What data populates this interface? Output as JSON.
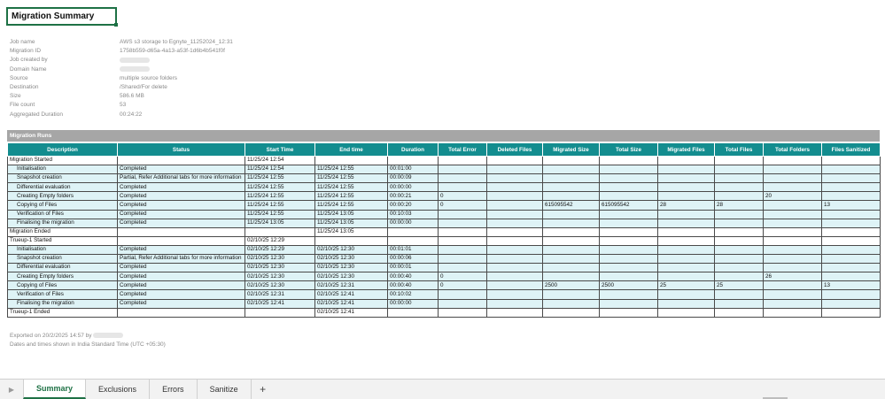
{
  "sheet": {
    "title": "Migration Summary"
  },
  "info": [
    {
      "label": "Job name",
      "value": "AWS s3 storage to Egnyte_11252024_12:31"
    },
    {
      "label": "Migration ID",
      "value": "1758b559-d65a-4a13-a53f-1d6b4b541f0f"
    },
    {
      "label": "Job created by",
      "value": ""
    },
    {
      "label": "Domain Name",
      "value": ""
    },
    {
      "label": "Source",
      "value": "multiple source folders"
    },
    {
      "label": "Destination",
      "value": "/Shared/For delete"
    },
    {
      "label": "Size",
      "value": "586.6 MB"
    },
    {
      "label": "File count",
      "value": "53"
    },
    {
      "label": "Aggregated Duration",
      "value": "00:24:22"
    }
  ],
  "runs": {
    "heading": "Migration Runs",
    "columns": [
      "Description",
      "Status",
      "Start Time",
      "End time",
      "Duration",
      "Total Error",
      "Deleted Files",
      "Migrated Size",
      "Total Size",
      "Migrated Files",
      "Total Files",
      "Total Folders",
      "Files Sanitized"
    ],
    "rows": [
      {
        "kind": "top",
        "cells": [
          "Migration Started",
          "",
          "11/25/24 12:54",
          "",
          "",
          "",
          "",
          "",
          "",
          "",
          "",
          "",
          ""
        ]
      },
      {
        "kind": "sub",
        "cells": [
          "Initialisation",
          "Completed",
          "11/25/24 12:54",
          "11/25/24 12:55",
          "00:01:00",
          "",
          "",
          "",
          "",
          "",
          "",
          "",
          ""
        ]
      },
      {
        "kind": "sub",
        "cells": [
          "Snapshot creation",
          "Partial, Refer Additional tabs for more information",
          "11/25/24 12:55",
          "11/25/24 12:55",
          "00:00:09",
          "",
          "",
          "",
          "",
          "",
          "",
          "",
          ""
        ]
      },
      {
        "kind": "sub",
        "cells": [
          "Differential evaluation",
          "Completed",
          "11/25/24 12:55",
          "11/25/24 12:55",
          "00:00:00",
          "",
          "",
          "",
          "",
          "",
          "",
          "",
          ""
        ]
      },
      {
        "kind": "sub",
        "cells": [
          "Creating Empty folders",
          "Completed",
          "11/25/24 12:55",
          "11/25/24 12:55",
          "00:00:21",
          "0",
          "",
          "",
          "",
          "",
          "",
          "20",
          ""
        ]
      },
      {
        "kind": "sub",
        "cells": [
          "Copying of Files",
          "Completed",
          "11/25/24 12:55",
          "11/25/24 12:55",
          "00:00:20",
          "0",
          "",
          "615095542",
          "615095542",
          "28",
          "28",
          "",
          "13"
        ]
      },
      {
        "kind": "sub",
        "cells": [
          "Verification of Files",
          "Completed",
          "11/25/24 12:55",
          "11/25/24 13:05",
          "00:10:03",
          "",
          "",
          "",
          "",
          "",
          "",
          "",
          ""
        ]
      },
      {
        "kind": "sub",
        "cells": [
          "Finalising the migration",
          "Completed",
          "11/25/24 13:05",
          "11/25/24 13:05",
          "00:00:00",
          "",
          "",
          "",
          "",
          "",
          "",
          "",
          ""
        ]
      },
      {
        "kind": "top",
        "cells": [
          "Migration Ended",
          "",
          "",
          "11/25/24 13:05",
          "",
          "",
          "",
          "",
          "",
          "",
          "",
          "",
          ""
        ]
      },
      {
        "kind": "top",
        "cells": [
          "Trueup-1 Started",
          "",
          "02/10/25 12:29",
          "",
          "",
          "",
          "",
          "",
          "",
          "",
          "",
          "",
          ""
        ]
      },
      {
        "kind": "sub",
        "cells": [
          "Initialisation",
          "Completed",
          "02/10/25 12:29",
          "02/10/25 12:30",
          "00:01:01",
          "",
          "",
          "",
          "",
          "",
          "",
          "",
          ""
        ]
      },
      {
        "kind": "sub",
        "cells": [
          "Snapshot creation",
          "Partial, Refer Additional tabs for more information",
          "02/10/25 12:30",
          "02/10/25 12:30",
          "00:00:06",
          "",
          "",
          "",
          "",
          "",
          "",
          "",
          ""
        ]
      },
      {
        "kind": "sub",
        "cells": [
          "Differential evaluation",
          "Completed",
          "02/10/25 12:30",
          "02/10/25 12:30",
          "00:00:01",
          "",
          "",
          "",
          "",
          "",
          "",
          "",
          ""
        ]
      },
      {
        "kind": "sub",
        "cells": [
          "Creating Empty folders",
          "Completed",
          "02/10/25 12:30",
          "02/10/25 12:30",
          "00:00:40",
          "0",
          "",
          "",
          "",
          "",
          "",
          "26",
          ""
        ]
      },
      {
        "kind": "sub",
        "cells": [
          "Copying of Files",
          "Completed",
          "02/10/25 12:30",
          "02/10/25 12:31",
          "00:00:40",
          "0",
          "",
          "2500",
          "2500",
          "25",
          "25",
          "",
          "13"
        ]
      },
      {
        "kind": "sub",
        "cells": [
          "Verification of Files",
          "Completed",
          "02/10/25 12:31",
          "02/10/25 12:41",
          "00:10:02",
          "",
          "",
          "",
          "",
          "",
          "",
          "",
          ""
        ]
      },
      {
        "kind": "sub",
        "cells": [
          "Finalising the migration",
          "Completed",
          "02/10/25 12:41",
          "02/10/25 12:41",
          "00:00:00",
          "",
          "",
          "",
          "",
          "",
          "",
          "",
          ""
        ]
      },
      {
        "kind": "top",
        "cells": [
          "Trueup-1 Ended",
          "",
          "",
          "02/10/25 12:41",
          "",
          "",
          "",
          "",
          "",
          "",
          "",
          "",
          ""
        ]
      }
    ]
  },
  "footer": {
    "exported_prefix": "Exported on 20/2/2025 14:57 by",
    "timezone_note": "Dates and times shown in India Standard Time (UTC +05:30)"
  },
  "tabs": {
    "nav_icon": "play-icon",
    "items": [
      "Summary",
      "Exclusions",
      "Errors",
      "Sanitize"
    ],
    "active": "Summary",
    "add_label": "+"
  }
}
